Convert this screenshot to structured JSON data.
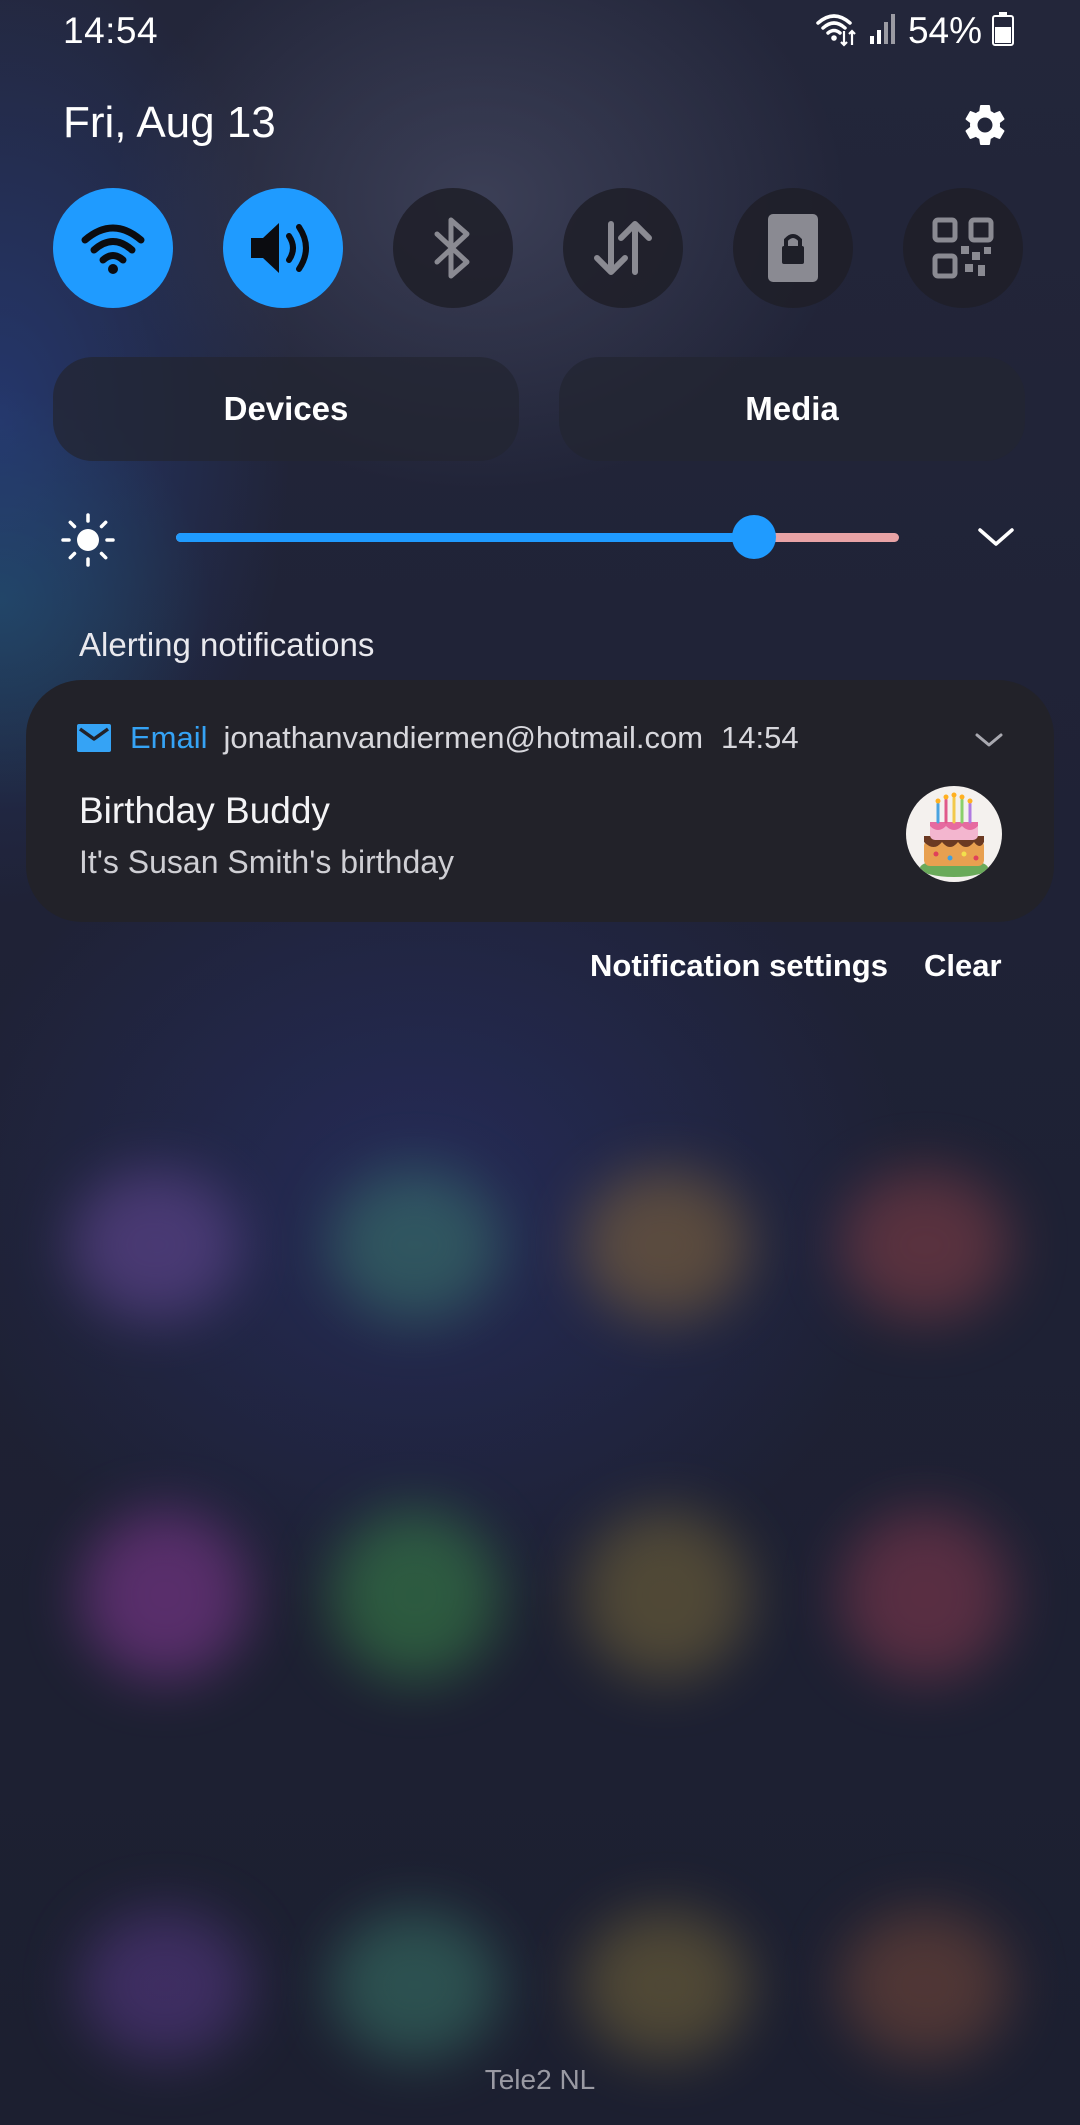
{
  "status_bar": {
    "time": "14:54",
    "battery_percent": "54%",
    "icons": [
      "wifi-data-icon",
      "signal-icon",
      "battery-icon"
    ]
  },
  "header": {
    "date": "Fri, Aug 13",
    "settings_icon": "gear-icon"
  },
  "quick_settings": {
    "toggles": [
      {
        "name": "wifi",
        "icon": "wifi-icon",
        "state": "on"
      },
      {
        "name": "sound",
        "icon": "sound-icon",
        "state": "on"
      },
      {
        "name": "bluetooth",
        "icon": "bluetooth-icon",
        "state": "off"
      },
      {
        "name": "mobile-data",
        "icon": "data-arrows-icon",
        "state": "off"
      },
      {
        "name": "screen-lock",
        "icon": "lock-icon",
        "state": "off"
      },
      {
        "name": "qr-scanner",
        "icon": "qr-code-icon",
        "state": "off"
      }
    ],
    "devices_label": "Devices",
    "media_label": "Media",
    "brightness_level": 0.8
  },
  "notifications": {
    "section_title": "Alerting notifications",
    "items": [
      {
        "app_icon": "email-icon",
        "app_name": "Email",
        "account": "jonathanvandiermen@hotmail.com",
        "time": "14:54",
        "title": "Birthday Buddy",
        "body": "It's Susan Smith's birthday",
        "thumbnail": "birthday-cake-icon"
      }
    ],
    "settings_label": "Notification settings",
    "clear_label": "Clear"
  },
  "carrier": "Tele2 NL",
  "colors": {
    "accent": "#1f9bff",
    "app_name": "#35a3f5",
    "card_bg": "#222229"
  }
}
